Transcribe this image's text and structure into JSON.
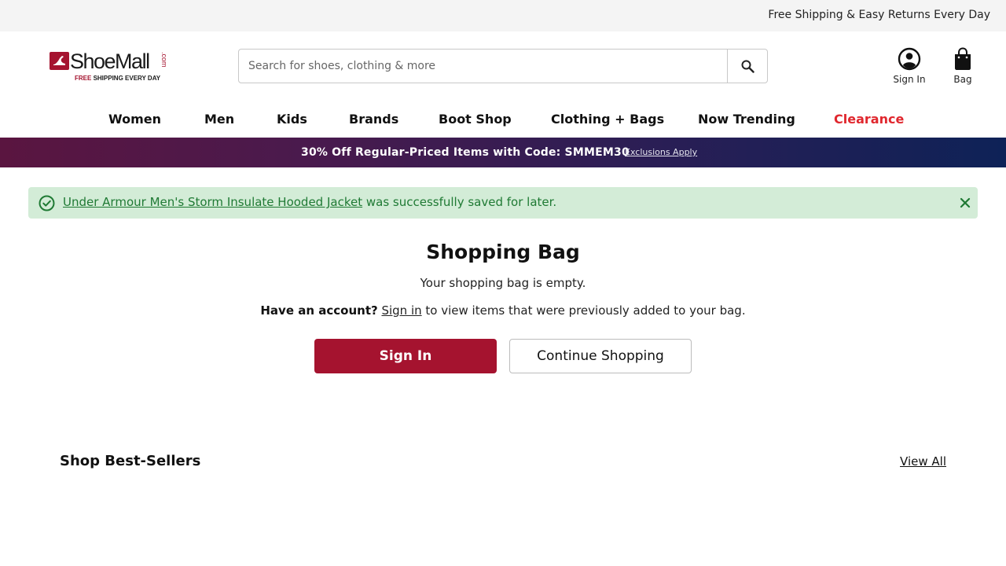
{
  "topbar": {
    "message": "Free Shipping & Easy Returns Every Day"
  },
  "logo": {
    "wordmark": "ShoeMall",
    "tld": ".com",
    "tagline_free": "FREE",
    "tagline_rest": " SHIPPING EVERY DAY"
  },
  "search": {
    "placeholder": "Search for shoes, clothing & more"
  },
  "header": {
    "signin_label": "Sign In",
    "bag_label": "Bag"
  },
  "nav": {
    "items": [
      {
        "label": "Women"
      },
      {
        "label": "Men"
      },
      {
        "label": "Kids"
      },
      {
        "label": "Brands"
      },
      {
        "label": "Boot Shop"
      },
      {
        "label": "Clothing + Bags"
      },
      {
        "label": "Now Trending"
      },
      {
        "label": "Clearance",
        "highlight_color": "#e0272e"
      }
    ]
  },
  "promo": {
    "text": "30% Off Regular-Priced Items with Code: SMMEM30",
    "link": "Exclusions Apply"
  },
  "alert": {
    "product_link": "Under Armour Men's Storm Insulate Hooded Jacket",
    "message": " was successfully saved for later."
  },
  "bag": {
    "title": "Shopping Bag",
    "empty_text": "Your shopping bag is empty.",
    "account_prompt": "Have an account?",
    "signin_link": "Sign in",
    "account_rest": " to view items that were previously added to your bag.",
    "signin_button": "Sign In",
    "continue_button": "Continue Shopping"
  },
  "bestsellers": {
    "title": "Shop Best-Sellers",
    "view_all": "View All"
  },
  "colors": {
    "brand": "#a5132f",
    "success_bg": "#d3ecd7",
    "success_text": "#1f7a34",
    "clearance": "#e0272e"
  }
}
